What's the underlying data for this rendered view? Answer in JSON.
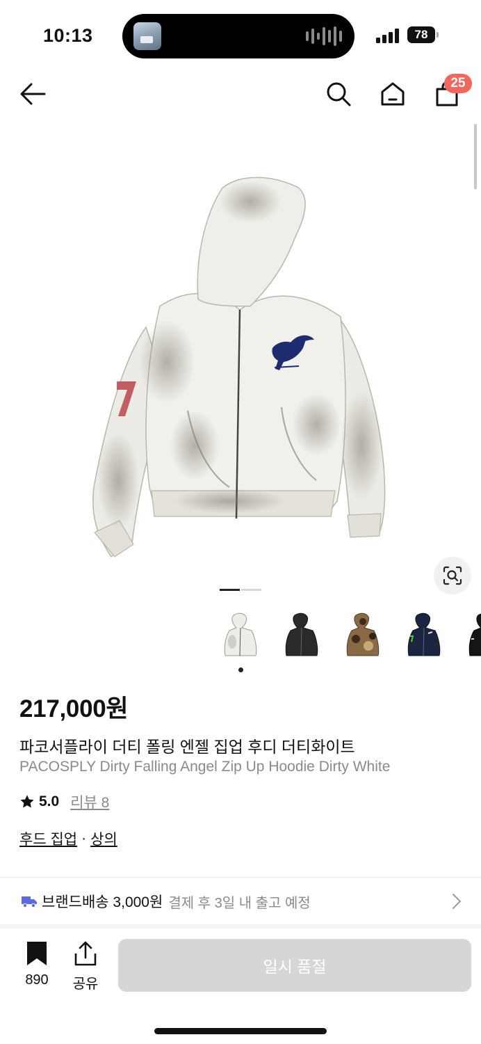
{
  "status_bar": {
    "time": "10:13",
    "battery": "78"
  },
  "nav": {
    "cart_count": "25"
  },
  "gallery": {
    "current_index": 1,
    "total": 2,
    "thumbnail_count": 5
  },
  "product": {
    "price": "217,000원",
    "name_ko": "파코서플라이 더티 폴링 엔젤 집업 후디 더티화이트",
    "name_en": "PACOSPLY Dirty Falling Angel Zip Up Hoodie Dirty White",
    "rating": "5.0",
    "review_label": "리뷰 8",
    "category_1": "후드 집업",
    "category_sep": "·",
    "category_2": "상의"
  },
  "shipping": {
    "label": "브랜드배송 3,000원",
    "note": "결제 후 3일 내 출고 예정"
  },
  "bottom_bar": {
    "bookmark_count": "890",
    "share_label": "공유",
    "buy_label": "일시 품절"
  },
  "colors": {
    "badge": "#f2665b",
    "buy_disabled": "#d6d6d6",
    "muted": "#8a8a8a"
  }
}
